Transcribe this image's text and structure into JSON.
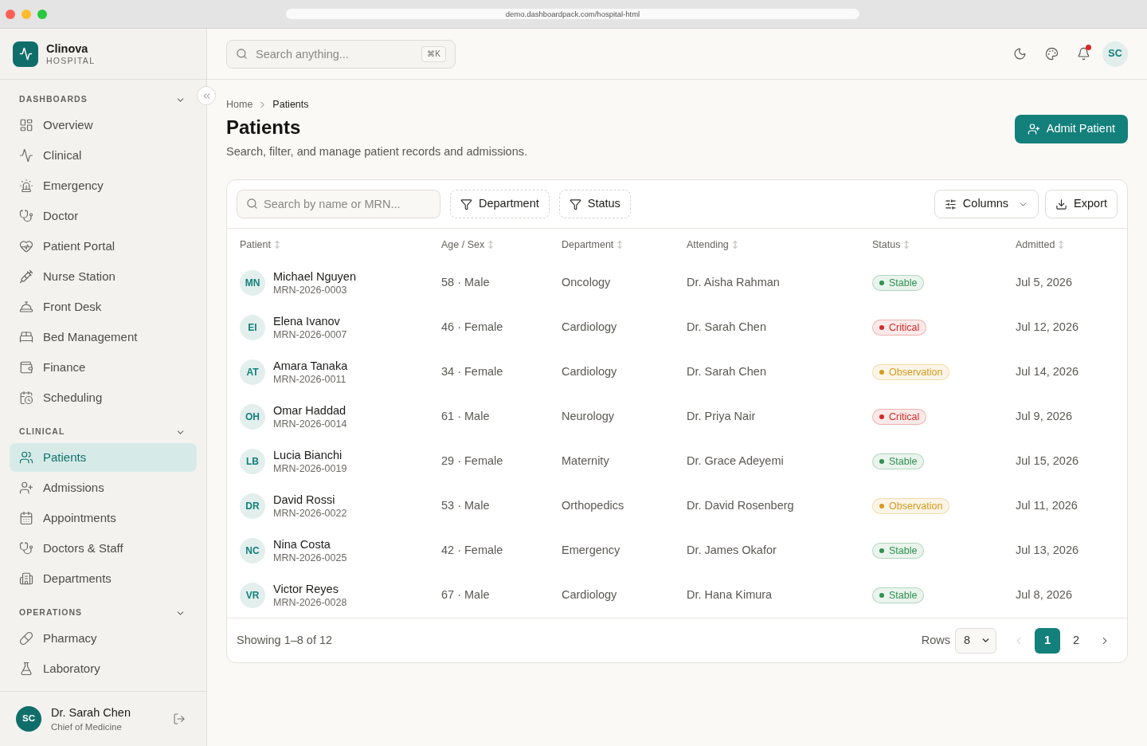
{
  "browser": {
    "url": "demo.dashboardpack.com/hospital-html"
  },
  "sidebar": {
    "brand": {
      "name": "Clinova",
      "subtitle": "HOSPITAL"
    },
    "sections": [
      {
        "title": "DASHBOARDS",
        "expanded": true,
        "items": [
          {
            "label": "Overview",
            "selected": false
          },
          {
            "label": "Clinical",
            "selected": false
          },
          {
            "label": "Emergency",
            "selected": false
          },
          {
            "label": "Doctor",
            "selected": false
          },
          {
            "label": "Patient Portal",
            "selected": false
          },
          {
            "label": "Nurse Station",
            "selected": false
          },
          {
            "label": "Front Desk",
            "selected": false
          },
          {
            "label": "Bed Management",
            "selected": false
          },
          {
            "label": "Finance",
            "selected": false
          },
          {
            "label": "Scheduling",
            "selected": false
          }
        ]
      },
      {
        "title": "CLINICAL",
        "expanded": true,
        "items": [
          {
            "label": "Patients",
            "selected": true
          },
          {
            "label": "Admissions",
            "selected": false
          },
          {
            "label": "Appointments",
            "selected": false
          },
          {
            "label": "Doctors & Staff",
            "selected": false
          },
          {
            "label": "Departments",
            "selected": false
          }
        ]
      },
      {
        "title": "OPERATIONS",
        "expanded": true,
        "items": [
          {
            "label": "Pharmacy",
            "selected": false
          },
          {
            "label": "Laboratory",
            "selected": false
          }
        ]
      }
    ],
    "user": {
      "initials": "SC",
      "name": "Dr. Sarah Chen",
      "role": "Chief of Medicine"
    }
  },
  "header": {
    "search": {
      "placeholder": "Search anything...",
      "shortcut": "⌘K"
    },
    "notifications": {
      "unread": true
    },
    "user": {
      "initials": "SC"
    }
  },
  "page": {
    "breadcrumb": [
      {
        "label": "Home",
        "current": false
      },
      {
        "label": "Patients",
        "current": true
      }
    ],
    "title": "Patients",
    "subtitle": "Search, filter, and manage patient records and admissions.",
    "primary_action": "Admit Patient"
  },
  "table": {
    "search": {
      "placeholder": "Search by name or MRN..."
    },
    "filters": [
      "Department",
      "Status"
    ],
    "columns_button": "Columns",
    "export_button": "Export",
    "columns": [
      {
        "label": "Patient",
        "sortable": true
      },
      {
        "label": "Age / Sex",
        "sortable": true
      },
      {
        "label": "Department",
        "sortable": true
      },
      {
        "label": "Attending",
        "sortable": true
      },
      {
        "label": "Status",
        "sortable": true
      },
      {
        "label": "Admitted",
        "sortable": true
      }
    ],
    "rows": [
      {
        "initials": "MN",
        "name": "Michael Nguyen",
        "mrn": "MRN-2026-0003",
        "age_sex": "58 · Male",
        "department": "Oncology",
        "attending": "Dr. Aisha Rahman",
        "status": {
          "label": "Stable",
          "color": "#2e9150"
        },
        "admitted": "Jul 5, 2026"
      },
      {
        "initials": "EI",
        "name": "Elena Ivanov",
        "mrn": "MRN-2026-0007",
        "age_sex": "46 · Female",
        "department": "Cardiology",
        "attending": "Dr. Sarah Chen",
        "status": {
          "label": "Critical",
          "color": "#d42a2a"
        },
        "admitted": "Jul 12, 2026"
      },
      {
        "initials": "AT",
        "name": "Amara Tanaka",
        "mrn": "MRN-2026-0011",
        "age_sex": "34 · Female",
        "department": "Cardiology",
        "attending": "Dr. Sarah Chen",
        "status": {
          "label": "Observation",
          "color": "#d69a1e"
        },
        "admitted": "Jul 14, 2026"
      },
      {
        "initials": "OH",
        "name": "Omar Haddad",
        "mrn": "MRN-2026-0014",
        "age_sex": "61 · Male",
        "department": "Neurology",
        "attending": "Dr. Priya Nair",
        "status": {
          "label": "Critical",
          "color": "#d42a2a"
        },
        "admitted": "Jul 9, 2026"
      },
      {
        "initials": "LB",
        "name": "Lucia Bianchi",
        "mrn": "MRN-2026-0019",
        "age_sex": "29 · Female",
        "department": "Maternity",
        "attending": "Dr. Grace Adeyemi",
        "status": {
          "label": "Stable",
          "color": "#2e9150"
        },
        "admitted": "Jul 15, 2026"
      },
      {
        "initials": "DR",
        "name": "David Rossi",
        "mrn": "MRN-2026-0022",
        "age_sex": "53 · Male",
        "department": "Orthopedics",
        "attending": "Dr. David Rosenberg",
        "status": {
          "label": "Observation",
          "color": "#d69a1e"
        },
        "admitted": "Jul 11, 2026"
      },
      {
        "initials": "NC",
        "name": "Nina Costa",
        "mrn": "MRN-2026-0025",
        "age_sex": "42 · Female",
        "department": "Emergency",
        "attending": "Dr. James Okafor",
        "status": {
          "label": "Stable",
          "color": "#2e9150"
        },
        "admitted": "Jul 13, 2026"
      },
      {
        "initials": "VR",
        "name": "Victor Reyes",
        "mrn": "MRN-2026-0028",
        "age_sex": "67 · Male",
        "department": "Cardiology",
        "attending": "Dr. Hana Kimura",
        "status": {
          "label": "Stable",
          "color": "#2e9150"
        },
        "admitted": "Jul 8, 2026"
      }
    ],
    "footer": {
      "summary": "Showing 1–8 of 12",
      "rows_label": "Rows",
      "rows_per_page": "8",
      "previous_disabled": true,
      "next_disabled": false,
      "pages": [
        {
          "label": "1",
          "selected": true
        },
        {
          "label": "2",
          "selected": false
        }
      ]
    }
  }
}
